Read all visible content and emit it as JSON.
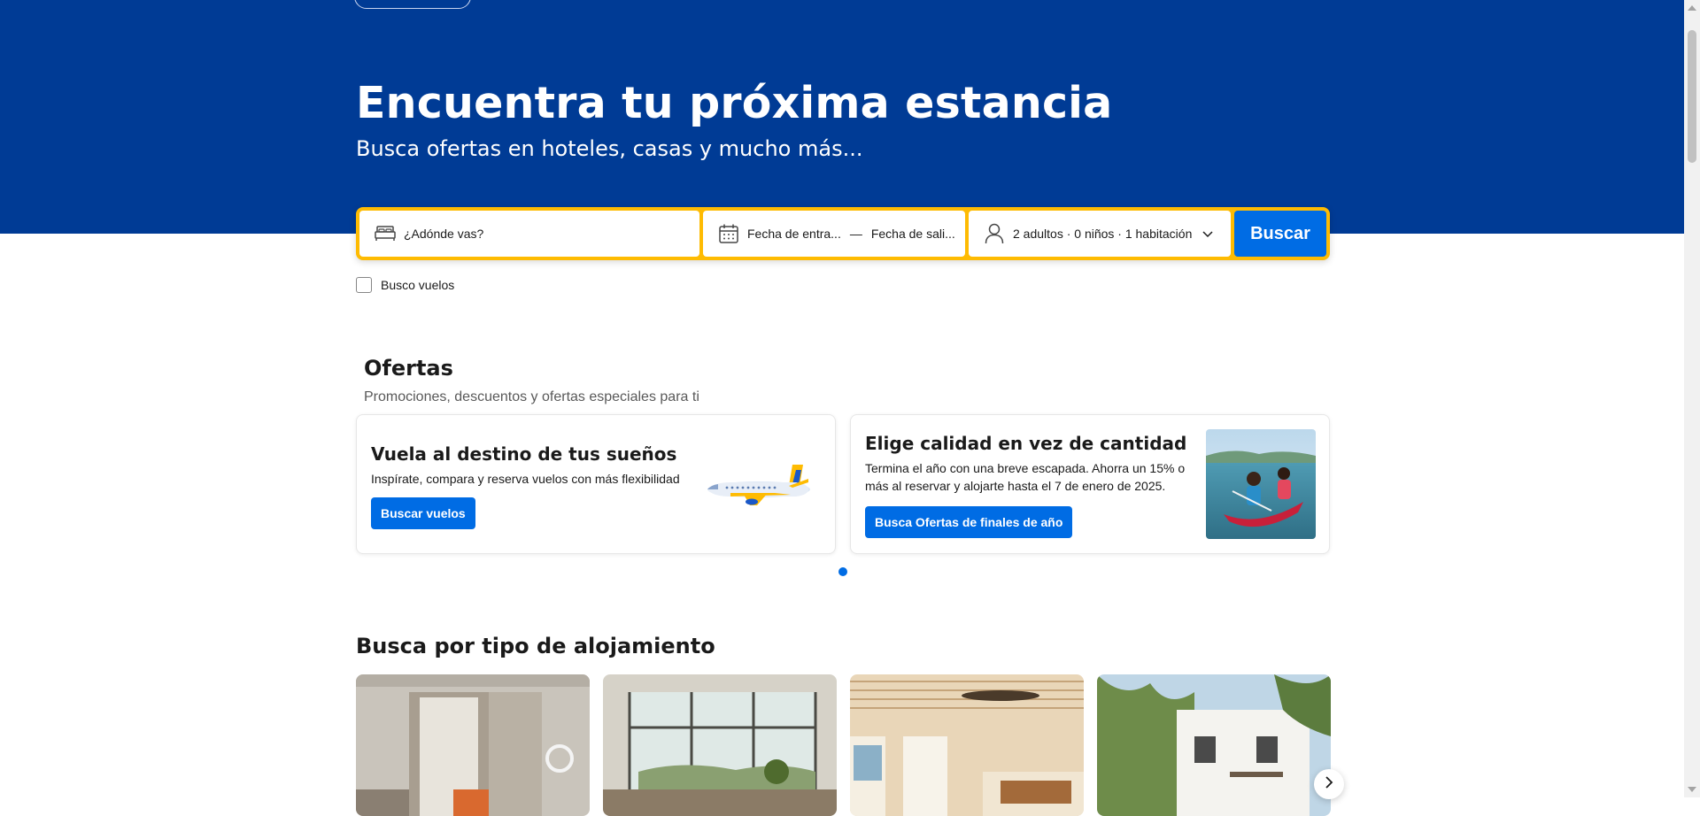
{
  "colors": {
    "brand_blue": "#003b95",
    "accent_blue": "#006ce4",
    "search_border": "#febb02",
    "text": "#1a1a1a",
    "muted": "#595959"
  },
  "hero": {
    "title": "Encuentra tu próxima estancia",
    "subtitle": "Busca ofertas en hoteles, casas y mucho más..."
  },
  "search": {
    "destination_placeholder": "¿Adónde vas?",
    "destination_icon": "bed-icon",
    "checkin_label": "Fecha de entra...",
    "checkout_label": "Fecha de sali...",
    "date_separator": "—",
    "dates_icon": "calendar-icon",
    "guests_label": "2 adultos · 0 niños · 1 habitación",
    "guests_icon": "person-icon",
    "submit_label": "Buscar"
  },
  "flights_checkbox": {
    "label": "Busco vuelos",
    "checked": false
  },
  "offers": {
    "title": "Ofertas",
    "subtitle": "Promociones, descuentos y ofertas especiales para ti",
    "cards": [
      {
        "title": "Vuela al destino de tus sueños",
        "text": "Inspírate, compara y reserva vuelos con más flexibilidad",
        "button": "Buscar vuelos",
        "image": "airplane-illustration"
      },
      {
        "title": "Elige calidad en vez de cantidad",
        "text": "Termina el año con una breve escapada. Ahorra un 15% o más al reservar y alojarte hasta el 7 de enero de 2025.",
        "button": "Busca Ofertas de finales de año",
        "image": "kayak-photo"
      }
    ],
    "carousel_active_page": 1,
    "carousel_pages": 1
  },
  "property_types": {
    "title": "Busca por tipo de alojamiento",
    "cards": [
      {
        "image": "hotel-room-photo"
      },
      {
        "image": "apartment-photo"
      },
      {
        "image": "resort-room-photo"
      },
      {
        "image": "villa-photo"
      }
    ],
    "next_icon": "chevron-right-icon"
  }
}
